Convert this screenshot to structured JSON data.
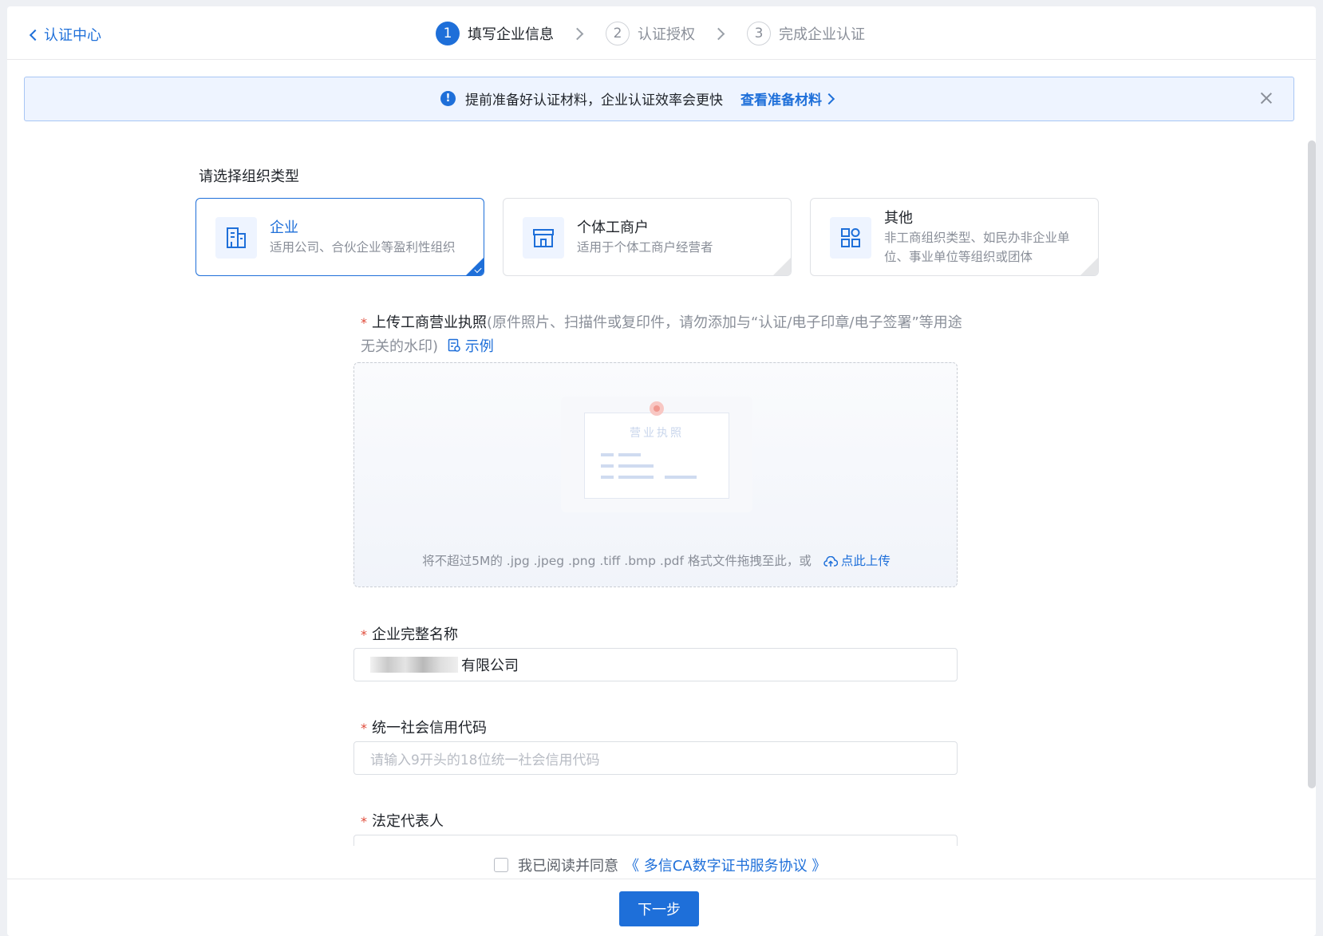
{
  "header": {
    "back_label": "认证中心",
    "steps": [
      {
        "num": "1",
        "label": "填写企业信息"
      },
      {
        "num": "2",
        "label": "认证授权"
      },
      {
        "num": "3",
        "label": "完成企业认证"
      }
    ]
  },
  "notice": {
    "text": "提前准备好认证材料，企业认证效率会更快",
    "link": "查看准备材料"
  },
  "org_type": {
    "title": "请选择组织类型",
    "selected": "企业",
    "cards": [
      {
        "title": "企业",
        "desc": "适用公司、合伙企业等盈利性组织"
      },
      {
        "title": "个体工商户",
        "desc": "适用于个体工商户经营者"
      },
      {
        "title": "其他",
        "desc": "非工商组织类型、如民办非企业单位、事业单位等组织或团体"
      }
    ]
  },
  "upload": {
    "required_mark": "*",
    "label": "上传工商营业执照",
    "hint": "(原件照片、扫描件或复印件，请勿添加与“认证/电子印章/电子签署”等用途无关的水印)",
    "example": "示例",
    "illustration_title": "营业执照",
    "drop_hint": "将不超过5M的 .jpg .jpeg .png .tiff .bmp .pdf 格式文件拖拽至此，或",
    "upload_link": "点此上传"
  },
  "form": {
    "company_name": {
      "label": "企业完整名称",
      "value": "有限公司"
    },
    "credit_code": {
      "label": "统一社会信用代码",
      "placeholder": "请输入9开头的18位统一社会信用代码"
    },
    "legal_rep": {
      "label": "法定代表人"
    }
  },
  "agreement": {
    "checked": false,
    "text": "我已阅读并同意",
    "link": "《 多信CA数字证书服务协议 》"
  },
  "footer": {
    "next_label": "下一步"
  },
  "colors": {
    "primary": "#1e6fd9",
    "required": "#e04b3a",
    "notice_bg": "#eef4ff"
  }
}
